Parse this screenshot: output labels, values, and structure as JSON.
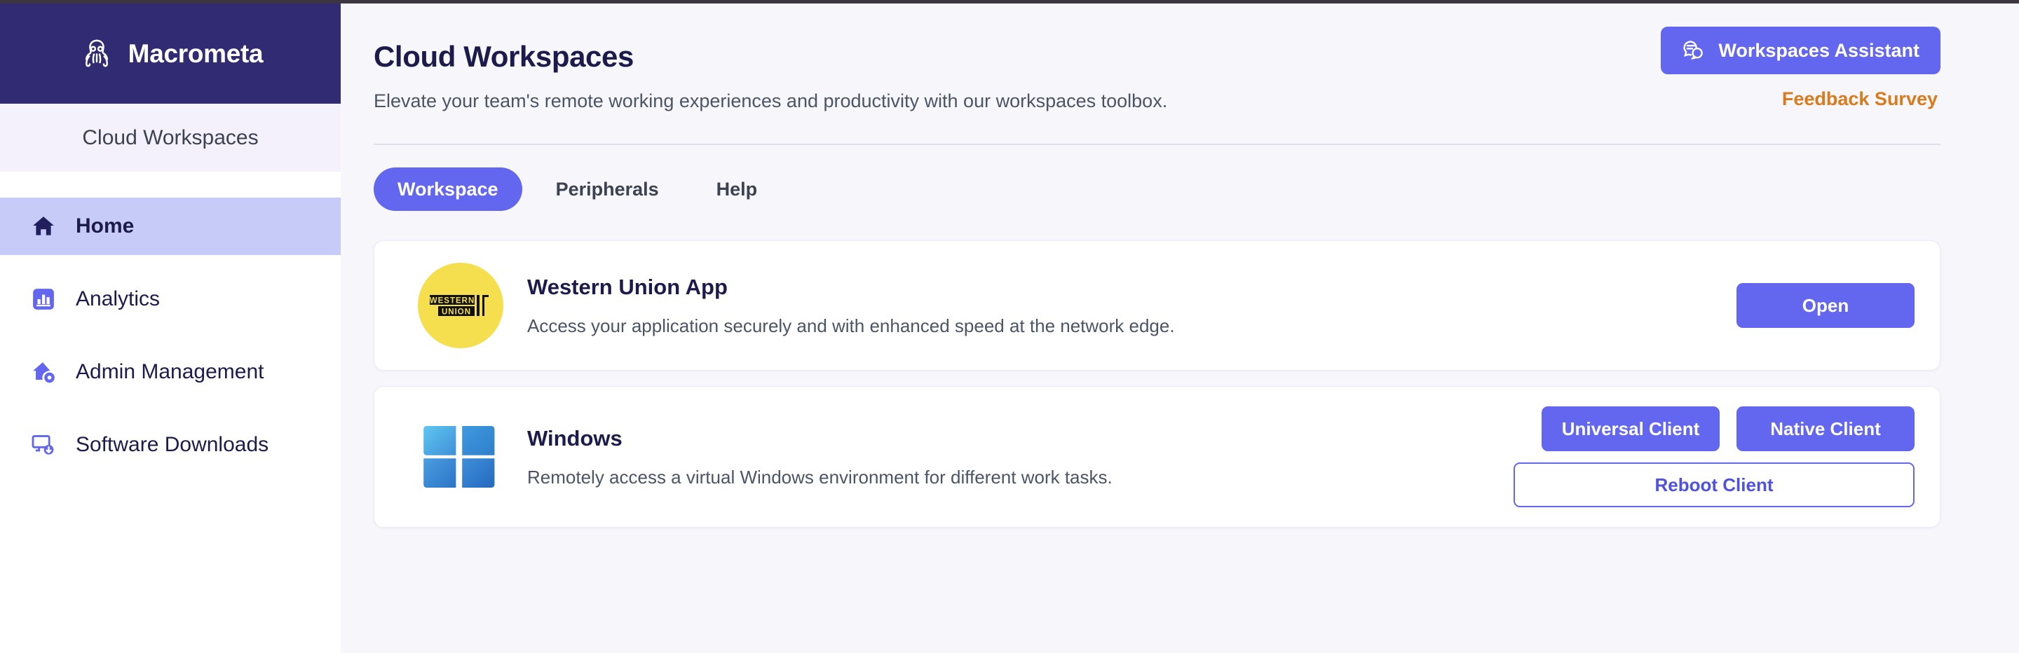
{
  "sidebar": {
    "brand_name": "Macrometa",
    "brand_logo_icon": "octopus-logo-icon",
    "subbrand_label": "Cloud Workspaces",
    "items": [
      {
        "label": "Home",
        "icon": "home-icon",
        "active": true
      },
      {
        "label": "Analytics",
        "icon": "bar-chart-icon",
        "active": false
      },
      {
        "label": "Admin Management",
        "icon": "home-gear-icon",
        "active": false
      },
      {
        "label": "Software Downloads",
        "icon": "monitor-download-icon",
        "active": false
      }
    ]
  },
  "header": {
    "title": "Cloud Workspaces",
    "subtitle": "Elevate your team's remote working experiences and productivity with our workspaces toolbox.",
    "assistant_button_label": "Workspaces Assistant",
    "assistant_button_icon": "chat-bubbles-icon",
    "feedback_link_label": "Feedback Survey",
    "accent_color": "#6366ef",
    "feedback_color": "#d97b1c"
  },
  "tabs": [
    {
      "label": "Workspace",
      "active": true
    },
    {
      "label": "Peripherals",
      "active": false
    },
    {
      "label": "Help",
      "active": false
    }
  ],
  "cards": [
    {
      "title": "Western Union App",
      "description": "Access your application securely and with enhanced speed at the network edge.",
      "logo_icon": "western-union-logo-icon",
      "logo_text_line1": "WESTERN",
      "logo_text_line2": "UNION",
      "logo_bg": "#f6df4f",
      "actions": [
        {
          "label": "Open",
          "style": "primary"
        }
      ]
    },
    {
      "title": "Windows",
      "description": "Remotely access a virtual Windows environment for different work tasks.",
      "logo_icon": "windows-logo-icon",
      "actions": [
        {
          "label": "Universal Client",
          "style": "primary"
        },
        {
          "label": "Native Client",
          "style": "primary"
        },
        {
          "label": "Reboot Client",
          "style": "outline"
        }
      ]
    }
  ]
}
